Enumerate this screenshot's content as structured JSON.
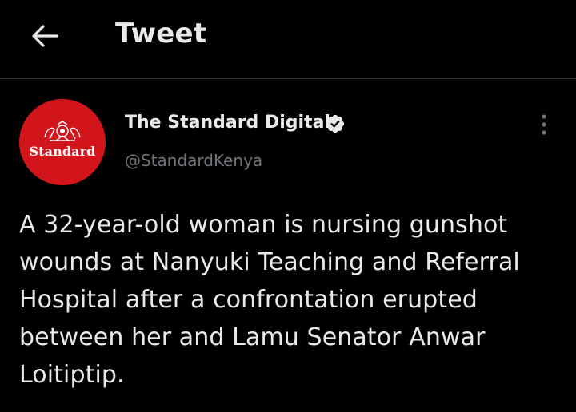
{
  "header": {
    "title": "Tweet",
    "back_icon": "arrow-left-icon"
  },
  "author": {
    "display_name": "The Standard Digital",
    "handle": "@StandardKenya",
    "verified": true,
    "avatar_text": "Standard",
    "avatar_color": "#d2141b"
  },
  "tweet": {
    "text": "A 32-year-old woman is nursing gunshot wounds at Nanyuki Teaching and Referral Hospital after a confrontation erupted between her and Lamu Senator Anwar Loitiptip."
  },
  "colors": {
    "background": "#000000",
    "text": "#e7e9ea",
    "secondary_text": "#71767b",
    "divider": "#2f3336"
  }
}
